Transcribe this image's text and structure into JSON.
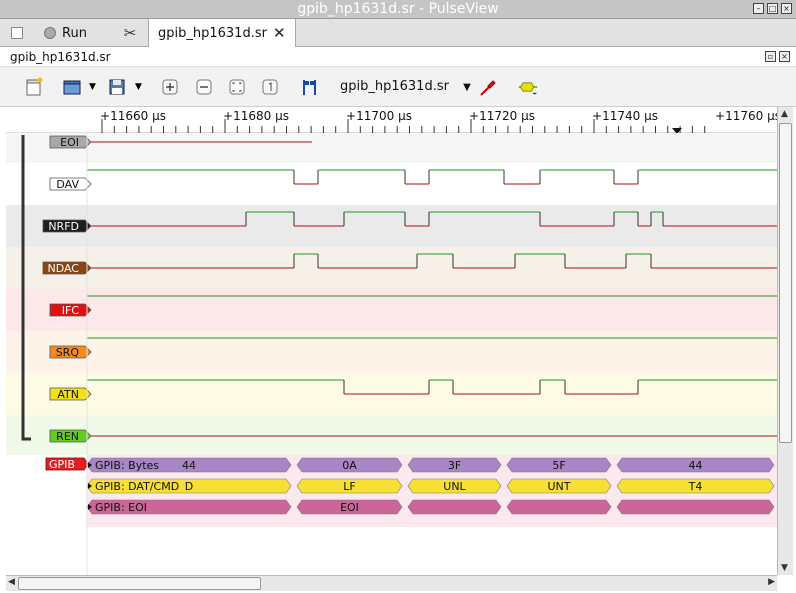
{
  "window": {
    "title": "gpib_hp1631d.sr - PulseView",
    "controls": [
      "minimize-icon",
      "maximize-icon",
      "close-icon"
    ]
  },
  "tabs": [
    {
      "label": "",
      "icon": "session-icon"
    },
    {
      "label": "Run",
      "icon": "run-icon"
    },
    {
      "label": "",
      "icon": "settings-icon"
    },
    {
      "label": "gpib_hp1631d.sr",
      "icon": "close-icon"
    }
  ],
  "view": {
    "header": "gpib_hp1631d.sr",
    "file_combo": "gpib_hp1631d.sr"
  },
  "toolbar": {
    "icons": [
      "new-view-icon",
      "open-icon",
      "save-icon",
      "zoom-in-icon",
      "zoom-out-icon",
      "zoom-fit-icon",
      "zoom-one-to-one-icon",
      "cursor-icon",
      "probe-icon",
      "decoder-icon"
    ]
  },
  "ruler": {
    "labels": [
      "+11660 µs",
      "+11680 µs",
      "+11700 µs",
      "+11720 µs",
      "+11740 µs",
      "+11760 µs"
    ]
  },
  "signals": [
    {
      "name": "EOI",
      "color": "#a8a8a8",
      "text_color": "#111"
    },
    {
      "name": "DAV",
      "color": "#ffffff",
      "text_color": "#111"
    },
    {
      "name": "NRFD",
      "color": "#1e1e1e",
      "text_color": "#fff"
    },
    {
      "name": "NDAC",
      "color": "#8b4513",
      "text_color": "#fff"
    },
    {
      "name": "IFC",
      "color": "#dd1111",
      "text_color": "#fff"
    },
    {
      "name": "SRQ",
      "color": "#f58a1f",
      "text_color": "#111"
    },
    {
      "name": "ATN",
      "color": "#f0e020",
      "text_color": "#111"
    },
    {
      "name": "REN",
      "color": "#66cc22",
      "text_color": "#111"
    }
  ],
  "decoder": {
    "name": "GPIB",
    "color": "#dd2222",
    "rows": [
      {
        "label": "GPIB: Bytes",
        "color": "#a885c5",
        "values": [
          "44",
          "0A",
          "3F",
          "5F",
          "44"
        ]
      },
      {
        "label": "GPIB: DAT/CMD",
        "color": "#f6e035",
        "values": [
          "D",
          "LF",
          "UNL",
          "UNT",
          "T4"
        ]
      },
      {
        "label": "GPIB: EOI",
        "color": "#cc6699",
        "values": [
          "",
          "EOI",
          "",
          "",
          ""
        ]
      }
    ]
  }
}
